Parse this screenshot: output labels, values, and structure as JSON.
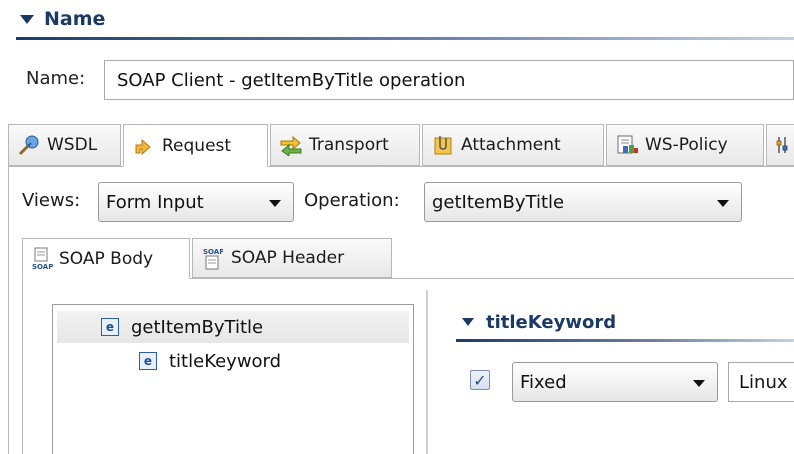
{
  "section": {
    "title": "Name"
  },
  "name_field": {
    "label": "Name:",
    "value": "SOAP Client - getItemByTitle operation"
  },
  "outer_tabs": [
    {
      "label": "WSDL",
      "icon": "wsdl-icon"
    },
    {
      "label": "Request",
      "icon": "request-icon",
      "active": true
    },
    {
      "label": "Transport",
      "icon": "transport-icon"
    },
    {
      "label": "Attachment",
      "icon": "attachment-icon"
    },
    {
      "label": "WS-Policy",
      "icon": "ws-policy-icon"
    }
  ],
  "views": {
    "label": "Views:",
    "selected": "Form Input"
  },
  "operation": {
    "label": "Operation:",
    "selected": "getItemByTitle"
  },
  "inner_tabs": [
    {
      "label": "SOAP Body",
      "icon": "soap-body-icon",
      "active": true
    },
    {
      "label": "SOAP Header",
      "icon": "soap-header-icon"
    }
  ],
  "tree": [
    {
      "badge": "e",
      "label": "getItemByTitle",
      "selected": true
    },
    {
      "badge": "e",
      "label": "titleKeyword"
    }
  ],
  "detail": {
    "title": "titleKeyword",
    "checked": true,
    "check_mark": "✓",
    "mode": "Fixed",
    "value": "Linux"
  },
  "icons": {
    "soap_text": "SOAP"
  },
  "colors": {
    "header_blue": "#1b3a63",
    "selection_gray": "#e6e6e6"
  }
}
